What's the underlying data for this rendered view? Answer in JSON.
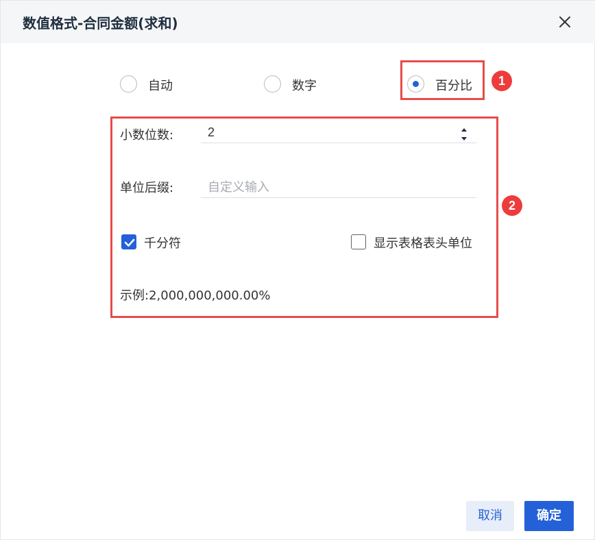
{
  "dialog": {
    "title": "数值格式-合同金额(求和)",
    "close_icon": "close-icon"
  },
  "format_options": {
    "selected": "percent",
    "items": [
      {
        "key": "auto",
        "label": "自动",
        "checked": false
      },
      {
        "key": "number",
        "label": "数字",
        "checked": false
      },
      {
        "key": "percent",
        "label": "百分比",
        "checked": true
      }
    ]
  },
  "annotations": {
    "badge_1": "1",
    "badge_2": "2",
    "color": "#e84b4b"
  },
  "settings": {
    "decimal_places": {
      "label": "小数位数:",
      "value": "2"
    },
    "unit_suffix": {
      "label": "单位后缀:",
      "value": "",
      "placeholder": "自定义输入"
    },
    "thousands_separator": {
      "label": "千分符",
      "checked": true
    },
    "show_header_unit": {
      "label": "显示表格表头单位",
      "checked": false
    },
    "example": "示例:2,000,000,000.00%"
  },
  "buttons": {
    "cancel": "取消",
    "ok": "确定"
  },
  "colors": {
    "accent": "#2461d9",
    "header_bg": "#f5f6f8",
    "annotation": "#e84b4b"
  }
}
